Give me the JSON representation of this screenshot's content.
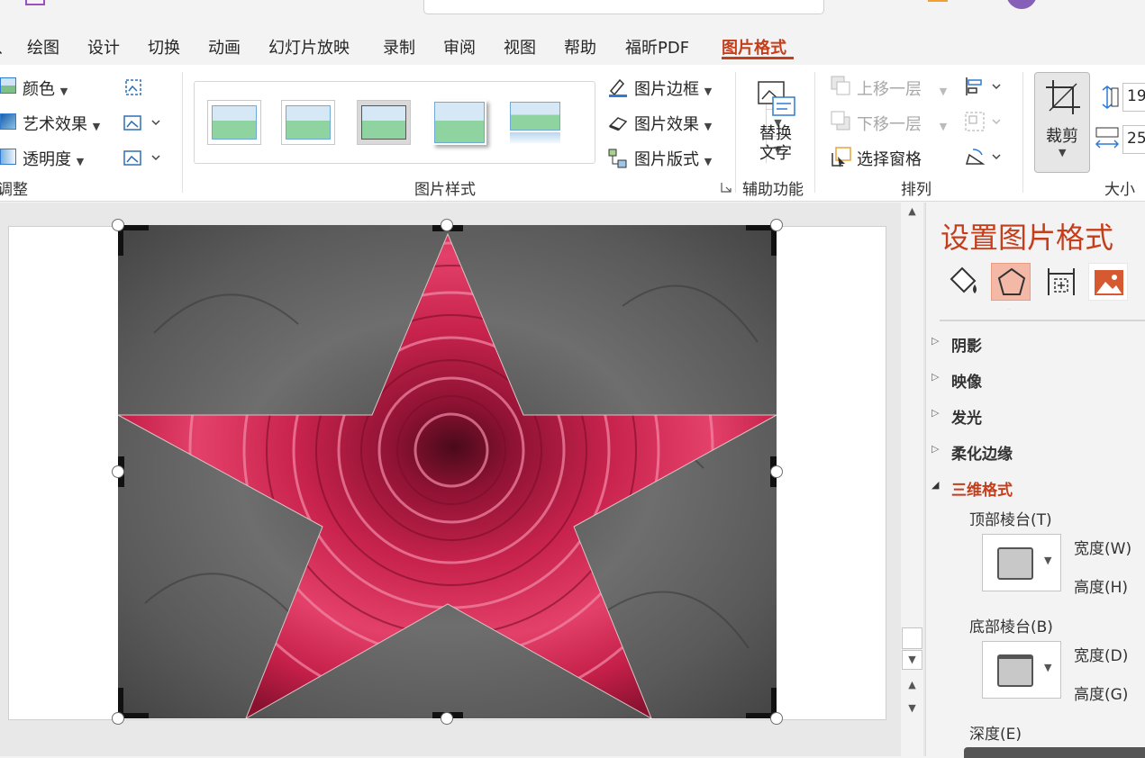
{
  "window": {
    "search_text": ""
  },
  "tabs": [
    {
      "label": "绘图"
    },
    {
      "label": "设计"
    },
    {
      "label": "切换"
    },
    {
      "label": "动画"
    },
    {
      "label": "幻灯片放映"
    },
    {
      "label": "录制"
    },
    {
      "label": "审阅"
    },
    {
      "label": "视图"
    },
    {
      "label": "帮助"
    },
    {
      "label": "福昕PDF"
    },
    {
      "label": "图片格式",
      "active": true
    }
  ],
  "ribbon": {
    "adjust": {
      "color": "颜色",
      "artistic": "艺术效果",
      "transparency": "透明度",
      "group_label": "调整"
    },
    "styles": {
      "border": "图片边框",
      "effects": "图片效果",
      "layout": "图片版式",
      "group_label": "图片样式"
    },
    "accessibility": {
      "alt_text_line1": "替换",
      "alt_text_line2": "文字",
      "group_label": "辅助功能"
    },
    "arrange": {
      "bring_forward": "上移一层",
      "send_backward": "下移一层",
      "selection_pane": "选择窗格",
      "group_label": "排列"
    },
    "size": {
      "crop": "裁剪",
      "height_value": "19",
      "width_value": "25",
      "group_label": "大小"
    }
  },
  "pane": {
    "title": "设置图片格式",
    "icons": [
      "fill-line-icon",
      "effects-pentagon-icon",
      "size-properties-icon",
      "picture-icon"
    ],
    "sections": [
      {
        "label": "阴影",
        "expanded": false
      },
      {
        "label": "映像",
        "expanded": false
      },
      {
        "label": "发光",
        "expanded": false
      },
      {
        "label": "柔化边缘",
        "expanded": false
      },
      {
        "label": "三维格式",
        "expanded": true
      }
    ],
    "top_bevel": "顶部棱台(T)",
    "bottom_bevel": "底部棱台(B)",
    "width_top": "宽度(W)",
    "height_top": "高度(H)",
    "width_bottom": "宽度(D)",
    "height_bottom": "高度(G)",
    "depth": "深度(E)"
  },
  "colors": {
    "accent": "#c43e1c",
    "ribbon_bg": "#ffffff",
    "window_bg": "#f3f3f3"
  }
}
